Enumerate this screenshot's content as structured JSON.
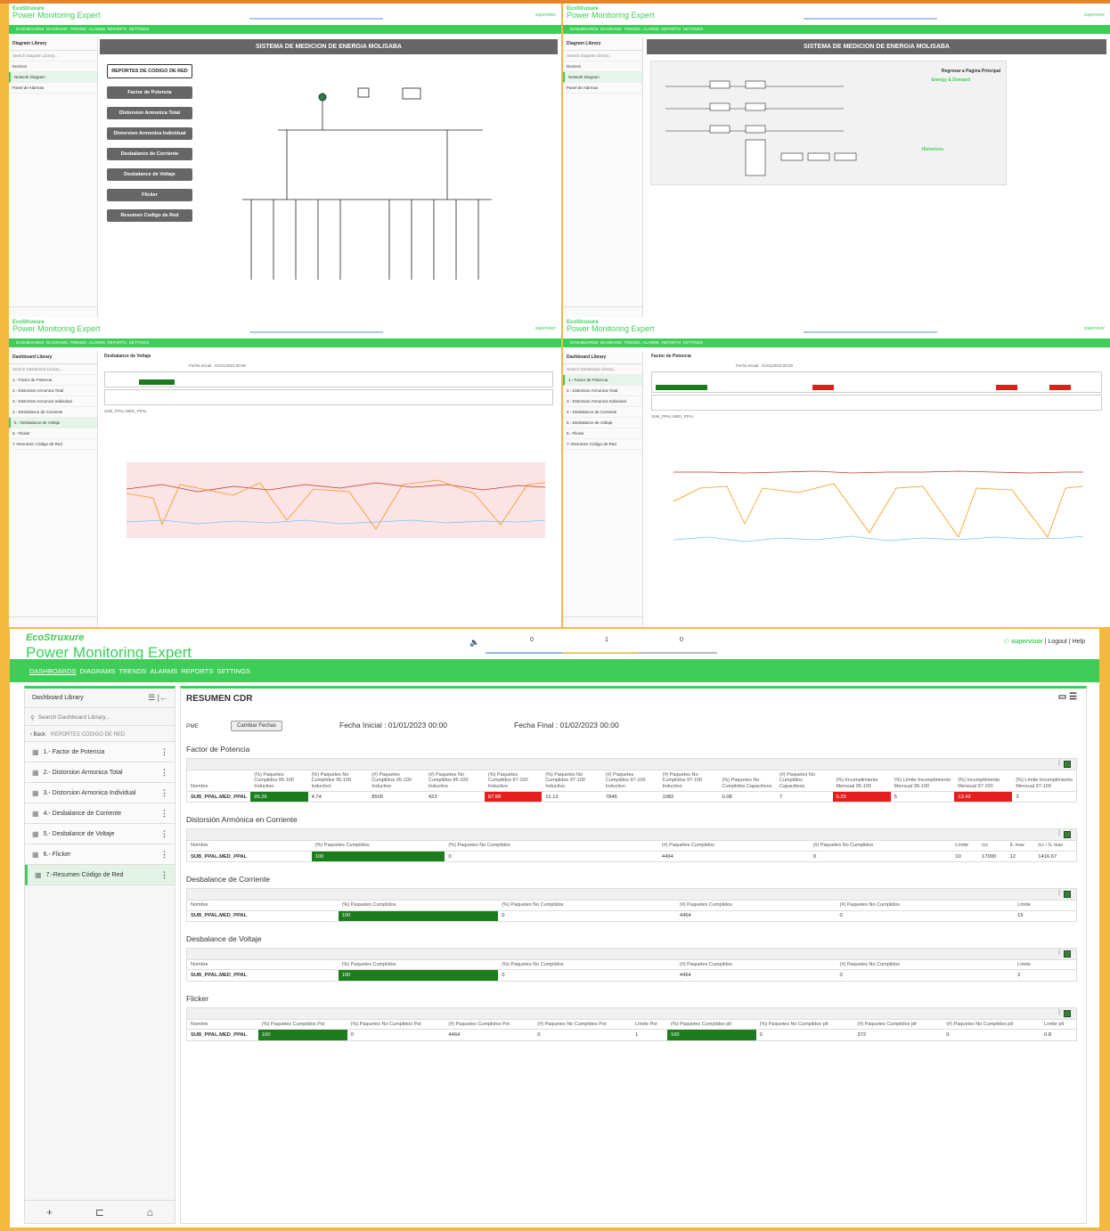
{
  "app": {
    "brand": "EcoStruxure",
    "product": "Power Monitoring Expert",
    "alarm_counts": [
      "0",
      "1",
      "0"
    ],
    "user": "supervisor",
    "logout": "Logout",
    "help": "Help",
    "nav": [
      "DASHBOARDS",
      "DIAGRAMS",
      "TRENDS",
      "ALARMS",
      "REPORTS",
      "SETTINGS"
    ]
  },
  "pane_diagram1": {
    "sidebar_title": "Diagram Library",
    "search_placeholder": "Search Diagram Library...",
    "items": [
      "Devices",
      "Network Diagram",
      "Panel de Alarmas"
    ],
    "title": "SISTEMA DE MEDICION DE ENERGIA MOLISABA",
    "buttons": [
      "REPORTES DE CODIGO DE RED",
      "Factor de Potencia",
      "Distorsion Armonica Total",
      "Distorsion Armonica Individual",
      "Desbalance de Corriente",
      "Desbalance de Voltaje",
      "Flicker",
      "Resumen Codigo de Red"
    ]
  },
  "pane_diagram2": {
    "title": "SISTEMA DE MEDICION DE ENERGIA MOLISABA",
    "back": "Regresar a Pagina Principal",
    "energy": "Energy & Demand",
    "historicos": "Historicos"
  },
  "pane_voltaje": {
    "title": "Desbalance de Voltaje",
    "fecha_inicial": "Fecha Inicial : 01/01/2023 00:00",
    "fecha_final": "Fecha Final : 01/02/2023 00:00",
    "sub": "SUB_PPAL.MED_PPAL"
  },
  "pane_fp": {
    "title": "Factor de Potencia",
    "fecha_inicial": "Fecha Inicial : 01/01/2023 00:00",
    "fecha_final": "Fecha Final : 01/02/2023 00:00",
    "sub": "SUB_PPAL.MED_PPAL"
  },
  "main": {
    "sidebar": {
      "title": "Dashboard Library",
      "search_placeholder": "Search Dashboard Library...",
      "back": "Back",
      "crumb": "REPORTES CODIGO DE RED",
      "items": [
        "1.- Factor de Potencia",
        "2.- Distorsion Armonica Total",
        "3.- Distorsion Armonica Individual",
        "4.- Desbalance de Corriente",
        "5.- Desbalance de Voltaje",
        "6.- Flicker",
        "7.-Resumen Código de Red"
      ]
    },
    "title": "RESUMEN CDR",
    "pme": "PME",
    "cambiar": "Cambiar Fechas",
    "fecha_inicial": "Fecha Inicial : 01/01/2023 00:00",
    "fecha_final": "Fecha Final : 01/02/2023 00:00",
    "fp": {
      "heading": "Factor de Potencia",
      "headers": [
        "Nombre",
        "(%) Paquetes Cumplidos 95-100 Inductivo",
        "(%) Paquetes No Cumplidos 95-100 Inductivo",
        "(#) Paquetes Cumplidos 95-100 Inductivo",
        "(#) Paquetes No Cumplidos 95-100 Inductivo",
        "(%) Paquetes Cumplidos 97-100 Inductivo",
        "(%) Paquetes No Cumplidos 97-100 Inductivo",
        "(#) Paquetes Cumplidos 97-100 Inductivo",
        "(#) Paquetes No Cumplidos 97-100 Inductivo",
        "(%) Paquetes No Cumplidos Capacitivos",
        "(#) Paquetes No Cumplidos Capacitivos",
        "(%) Incumplimiento Mensual 95-100",
        "(%) Límite Incumplimiento Mensual 95-100",
        "(%) Incumplimiento Mensual 97-100",
        "(%) Límite Incumplimiento Mensual 97-100"
      ],
      "row": [
        "SUB_PPAL.MED_PPAL",
        "95.26",
        "4.74",
        "8505",
        "423",
        "87.88",
        "12.12",
        "7846",
        "1082",
        "0.08",
        "7",
        "5.25",
        "5",
        "13.42",
        "3"
      ]
    },
    "dac": {
      "heading": "Distorsión Armónica en Corriente",
      "headers": [
        "Nombre",
        "(%) Paquetes Cumplidos",
        "(%) Paquetes No Cumplidos",
        "(#) Paquetes Cumplidos",
        "(#) Paquetes No Cumplidos",
        "Límite",
        "Icc",
        "IL max",
        "Icc / IL max"
      ],
      "row": [
        "SUB_PPAL.MED_PPAL",
        "100",
        "0",
        "4464",
        "0",
        "10",
        "17000",
        "12",
        "1416.67"
      ]
    },
    "dcor": {
      "heading": "Desbalance de Corriente",
      "headers": [
        "Nombre",
        "(%) Paquetes Cumplidos",
        "(%) Paquetes No Cumplidos",
        "(#) Paquetes Cumplidos",
        "(#) Paquetes No Cumplidos",
        "Límite"
      ],
      "row": [
        "SUB_PPAL.MED_PPAL",
        "100",
        "0",
        "4464",
        "0",
        "15"
      ]
    },
    "dvol": {
      "heading": "Desbalance de Voltaje",
      "headers": [
        "Nombre",
        "(%) Paquetes Cumplidos",
        "(%) Paquetes No Cumplidos",
        "(#) Paquetes Cumplidos",
        "(#) Paquetes No Cumplidos",
        "Límite"
      ],
      "row": [
        "SUB_PPAL.MED_PPAL",
        "100",
        "0",
        "4464",
        "0",
        "2"
      ]
    },
    "flicker": {
      "heading": "Flicker",
      "headers": [
        "Nombre",
        "(%) Paquetes Cumplidos Pst",
        "(%) Paquetes No Cumplidos Pst",
        "(#) Paquetes Cumplidos Pst",
        "(#) Paquetes No Cumplidos Pst",
        "Límite Pst",
        "(%) Paquetes Cumplidos plt",
        "(%) Paquetes No Cumplidos plt",
        "(#) Paquetes Cumplidos plt",
        "(#) Paquetes No Cumplidos plt",
        "Límite plt"
      ],
      "row": [
        "SUB_PPAL.MED_PPAL",
        "100",
        "0",
        "4464",
        "0",
        "1",
        "100",
        "0",
        "372",
        "0",
        "0.8"
      ]
    }
  }
}
